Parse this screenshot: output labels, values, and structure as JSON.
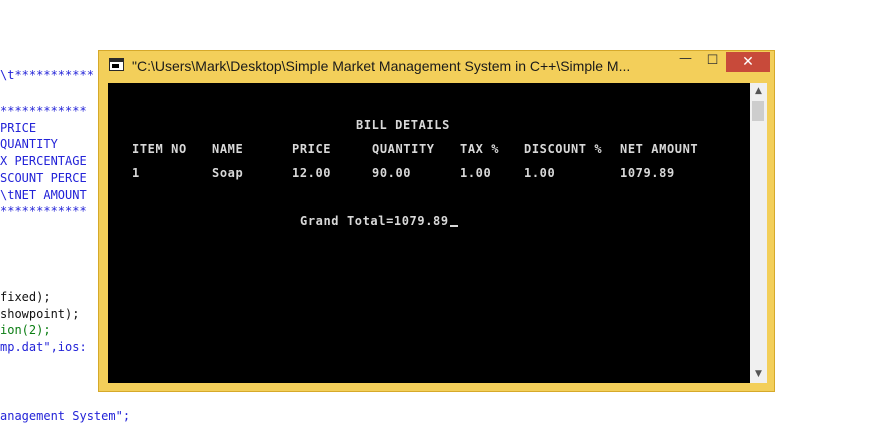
{
  "editor": {
    "lines": [
      {
        "text": "\\t***********",
        "color": "#2323d8"
      },
      {
        "text": "************",
        "color": "#2323d8"
      },
      {
        "text": "PRICE",
        "color": "#2323d8"
      },
      {
        "text": "QUANTITY",
        "color": "#2323d8"
      },
      {
        "text": "X PERCENTAGE",
        "color": "#2323d8"
      },
      {
        "text": "SCOUNT PERCE",
        "color": "#2323d8"
      },
      {
        "text": "\\tNET AMOUNT",
        "color": "#2323d8"
      },
      {
        "text": "************",
        "color": "#2323d8"
      },
      {
        "text": "fixed);",
        "color": "#111111"
      },
      {
        "text": "showpoint);",
        "color": "#111111"
      },
      {
        "text": "ion(2);",
        "color": "#0a7d12"
      },
      {
        "text": "mp.dat\",ios:",
        "color": "#2323d8"
      },
      {
        "text": "anagement System\";",
        "color": "#2323d8"
      }
    ]
  },
  "window": {
    "title": "\"C:\\Users\\Mark\\Desktop\\Simple Market Management System in C++\\Simple M...",
    "minimize": "—",
    "maximize": "☐",
    "close": "✕",
    "border_color": "#f3cf5a"
  },
  "console": {
    "heading": "BILL DETAILS",
    "headers": [
      "ITEM NO",
      "NAME",
      "PRICE",
      "QUANTITY",
      "TAX %",
      "DISCOUNT %",
      "NET AMOUNT"
    ],
    "row": [
      "1",
      "Soap",
      "12.00",
      "90.00",
      "1.00",
      "1.00",
      "1079.89"
    ],
    "grand_total": "Grand Total=1079.89"
  },
  "scrollbar": {
    "up_icon": "▲",
    "down_icon": "▼"
  }
}
